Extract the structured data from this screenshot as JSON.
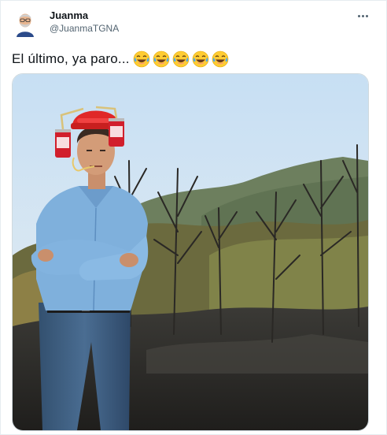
{
  "author": {
    "name": "Juanma",
    "handle": "@JuanmaTGNA",
    "avatar_icon": "memoji-avatar"
  },
  "tweet": {
    "text": "El último, ya paro...",
    "emoji_names": [
      "tears-of-joy-emoji",
      "tears-of-joy-emoji",
      "tears-of-joy-emoji",
      "tears-of-joy-emoji",
      "tears-of-joy-emoji"
    ]
  },
  "actions": {
    "more_icon": "more-dots-icon"
  },
  "colors": {
    "name": "#0f1419",
    "handle": "#536471",
    "border": "#cfd9de",
    "emoji_yellow": "#ffcc33"
  }
}
